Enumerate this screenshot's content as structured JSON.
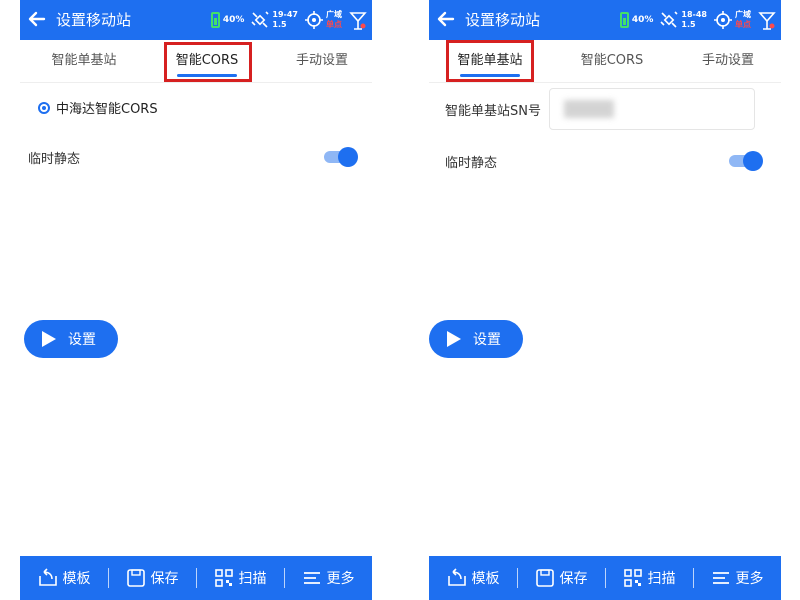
{
  "left": {
    "title": "设置移动站",
    "status": {
      "battery": "40%",
      "sat_top": "19-47",
      "sat_bottom": "1.5",
      "gps_top": "广域",
      "gps_bottom": "单点"
    },
    "tabs": [
      {
        "label": "智能单基站",
        "active": false
      },
      {
        "label": "智能CORS",
        "active": true
      },
      {
        "label": "手动设置",
        "active": false
      }
    ],
    "radio_label": "中海达智能CORS",
    "temp_static_label": "临时静态",
    "temp_static_on": true,
    "set_button": "设置",
    "bottom": {
      "template": "模板",
      "save": "保存",
      "scan": "扫描",
      "more": "更多"
    }
  },
  "right": {
    "title": "设置移动站",
    "status": {
      "battery": "40%",
      "sat_top": "18-48",
      "sat_bottom": "1.5",
      "gps_top": "广域",
      "gps_bottom": "单点"
    },
    "tabs": [
      {
        "label": "智能单基站",
        "active": true
      },
      {
        "label": "智能CORS",
        "active": false
      },
      {
        "label": "手动设置",
        "active": false
      }
    ],
    "sn_label": "智能单基站SN号",
    "sn_value": "",
    "temp_static_label": "临时静态",
    "temp_static_on": true,
    "set_button": "设置",
    "bottom": {
      "template": "模板",
      "save": "保存",
      "scan": "扫描",
      "more": "更多"
    }
  },
  "colors": {
    "primary": "#1e6ff0",
    "highlight_box": "#d62020",
    "battery": "#43e06a",
    "status_red": "#ff4a4a"
  }
}
